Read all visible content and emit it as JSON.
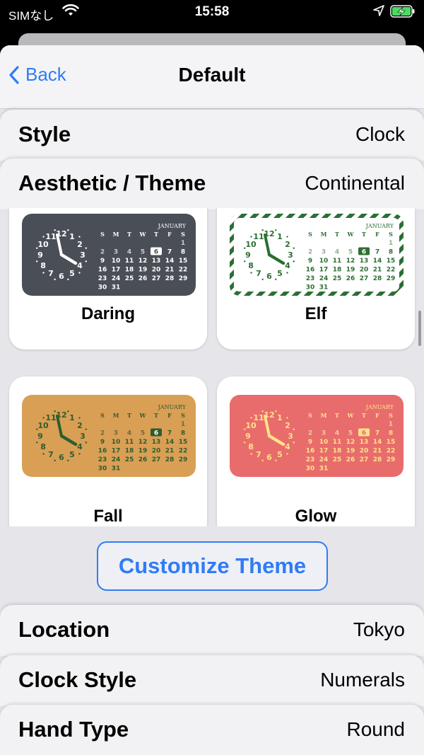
{
  "status_bar": {
    "carrier": "SIMなし",
    "time": "15:58"
  },
  "nav": {
    "back_label": "Back",
    "title": "Default"
  },
  "rows": {
    "style": {
      "label": "Style",
      "value": "Clock"
    },
    "theme": {
      "label": "Aesthetic / Theme",
      "value": "Continental"
    },
    "location": {
      "label": "Location",
      "value": "Tokyo"
    },
    "clock_style": {
      "label": "Clock Style",
      "value": "Numerals"
    },
    "hand_type": {
      "label": "Hand Type",
      "value": "Round"
    }
  },
  "themes": [
    {
      "name": "Daring",
      "bg": "#4a4f57",
      "fg": "#ffffff",
      "hand": "#ffffff",
      "highlight_bg": "#ffffff",
      "highlight_fg": "#4a4f57",
      "muted": "#c9ccd2",
      "border": false
    },
    {
      "name": "Elf",
      "bg": "#ffffff",
      "fg": "#2c6e33",
      "hand": "#2c6e33",
      "highlight_bg": "#2c6e33",
      "highlight_fg": "#ffffff",
      "muted": "#8fb293",
      "border": true
    },
    {
      "name": "Fall",
      "bg": "#d99f55",
      "fg": "#2c5d2e",
      "hand": "#2c5d2e",
      "highlight_bg": "#2c5d2e",
      "highlight_fg": "#ffffff",
      "muted": "#6f6a3c",
      "border": false
    },
    {
      "name": "Glow",
      "bg": "#e86c6c",
      "fg": "#ffe28a",
      "hand": "#ffe28a",
      "highlight_bg": "#ffe28a",
      "highlight_fg": "#e86c6c",
      "muted": "#f7c7a6",
      "border": false
    }
  ],
  "calendar": {
    "month": "JANUARY",
    "weekdays": [
      "S",
      "M",
      "T",
      "W",
      "T",
      "F",
      "S"
    ],
    "weeks": [
      [
        "",
        "",
        "",
        "",
        "",
        "",
        "1"
      ],
      [
        "2",
        "3",
        "4",
        "5",
        "6",
        "7",
        "8"
      ],
      [
        "9",
        "10",
        "11",
        "12",
        "13",
        "14",
        "15"
      ],
      [
        "16",
        "17",
        "18",
        "19",
        "20",
        "21",
        "22"
      ],
      [
        "23",
        "24",
        "25",
        "26",
        "27",
        "28",
        "29"
      ],
      [
        "30",
        "31",
        "",
        "",
        "",
        "",
        ""
      ]
    ],
    "today": "6",
    "clock_numerals": [
      "12",
      "1",
      "2",
      "3",
      "4",
      "5",
      "6",
      "7",
      "8",
      "9",
      "10",
      "11"
    ]
  },
  "customize_button": "Customize Theme",
  "colors": {
    "accent": "#2f7cf6",
    "battery": "#4cd964"
  }
}
